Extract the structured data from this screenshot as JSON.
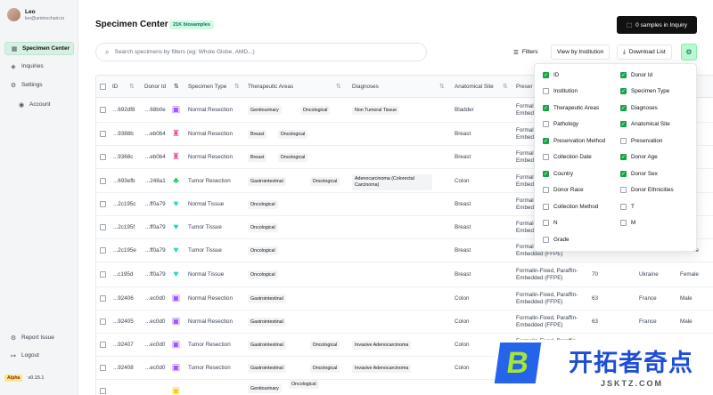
{
  "user": {
    "name": "Leo",
    "email": "leo@aminochain.io"
  },
  "nav": {
    "specimen_center": "Specimen Center",
    "inquiries": "Inquiries",
    "settings": "Settings",
    "account": "Account",
    "report_issue": "Report Issue",
    "logout": "Logout"
  },
  "version": {
    "badge": "Alpha",
    "number": "v0.15.1"
  },
  "header": {
    "title": "Specimen Center",
    "count_badge": "21K biosamples",
    "inquiry_button": "0 samples in Inquiry"
  },
  "search": {
    "placeholder": "Search specimens by filters (eg: Whole Globe, AMD...)"
  },
  "toolbar": {
    "filters": "Filters",
    "view_by_institution": "View by Institution",
    "download_list": "Download List"
  },
  "table": {
    "columns": [
      "ID",
      "Donor Id",
      "Specimen Type",
      "Therapeutic Areas",
      "Diagnoses",
      "Anatomical Site",
      "Preser"
    ],
    "rows": [
      {
        "id": "...692df8",
        "donor": "...68b0e",
        "icon": "ico-purple",
        "type": "Normal Resection",
        "areas": [
          "Genitourinary",
          "Oncological"
        ],
        "diagnosis": "Non Tumoral Tissue",
        "site": "Bladder",
        "pres": [
          "Formal",
          "Embedd"
        ],
        "age": "",
        "country": "",
        "sex": ""
      },
      {
        "id": "...9388b",
        "donor": "...eb0b4",
        "icon": "ico-pink",
        "type": "Normal Resection",
        "areas": [
          "Breast",
          "Oncological"
        ],
        "diagnosis": "",
        "site": "Breast",
        "pres": [
          "Formal",
          "Embedd"
        ],
        "age": "",
        "country": "",
        "sex": ""
      },
      {
        "id": "...9368c",
        "donor": "...eb0b4",
        "icon": "ico-pink",
        "type": "Normal Resection",
        "areas": [
          "Breast",
          "Oncological"
        ],
        "diagnosis": "",
        "site": "Breast",
        "pres": [
          "Formal",
          "Embedd"
        ],
        "age": "",
        "country": "",
        "sex": ""
      },
      {
        "id": "...693efb",
        "donor": "...248a1",
        "icon": "ico-green",
        "type": "Tumor Resection",
        "areas": [
          "Gastrointestinal",
          "Oncological"
        ],
        "diagnosis": "Adenocarcinoma (Colorectal Carcinoma)",
        "site": "Colon",
        "pres": [
          "Formal",
          "Embedd"
        ],
        "age": "",
        "country": "",
        "sex": ""
      },
      {
        "id": "...2c195c",
        "donor": "...ff0a79",
        "icon": "ico-teal",
        "type": "Normal Tissue",
        "areas": [
          "Oncological"
        ],
        "diagnosis": "",
        "site": "Breast",
        "pres": [
          "Formal",
          "Embedd"
        ],
        "age": "",
        "country": "",
        "sex": ""
      },
      {
        "id": "...2c195f",
        "donor": "...ff0a79",
        "icon": "ico-teal",
        "type": "Tumor Tissue",
        "areas": [
          "Oncological"
        ],
        "diagnosis": "",
        "site": "Breast",
        "pres": [
          "Formal",
          "Embedd"
        ],
        "age": "",
        "country": "",
        "sex": ""
      },
      {
        "id": "...2c195e",
        "donor": "...ff0a79",
        "icon": "ico-teal",
        "type": "Tumor Tissue",
        "areas": [
          "Oncological"
        ],
        "diagnosis": "",
        "site": "Breast",
        "pres": [
          "Formal",
          "Embedded (FFPE)"
        ],
        "age": "70",
        "country": "Ukraine",
        "sex": "Female"
      },
      {
        "id": "...c195d",
        "donor": "...ff0a79",
        "icon": "ico-teal",
        "type": "Normal Tissue",
        "areas": [
          "Oncological"
        ],
        "diagnosis": "",
        "site": "Breast",
        "pres": [
          "Formalin-Fixed, Paraffin-",
          "Embedded (FFPE)"
        ],
        "age": "70",
        "country": "Ukraine",
        "sex": "Female"
      },
      {
        "id": "...92406",
        "donor": "...ec0d0",
        "icon": "ico-purple",
        "type": "Normal Resection",
        "areas": [
          "Gastrointestinal"
        ],
        "diagnosis": "",
        "site": "Colon",
        "pres": [
          "Formalin-Fixed, Paraffin-",
          "Embedded (FFPE)"
        ],
        "age": "63",
        "country": "France",
        "sex": "Male"
      },
      {
        "id": "...92405",
        "donor": "...ec0d0",
        "icon": "ico-purple",
        "type": "Normal Resection",
        "areas": [
          "Gastrointestinal"
        ],
        "diagnosis": "",
        "site": "Colon",
        "pres": [
          "Formalin-Fixed, Paraffin-",
          "Embedded (FFPE)"
        ],
        "age": "63",
        "country": "France",
        "sex": "Male"
      },
      {
        "id": "...92407",
        "donor": "...ec0d0",
        "icon": "ico-purple",
        "type": "Tumor Resection",
        "areas": [
          "Gastrointestinal",
          "Oncological"
        ],
        "diagnosis": "Invasive Adenocarcinoma",
        "site": "Colon",
        "pres": [
          "Formalin-Fixed, Paraffin-",
          "Embedded (FFPE)"
        ],
        "age": "",
        "country": "",
        "sex": ""
      },
      {
        "id": "...92408",
        "donor": "...ec0d0",
        "icon": "ico-purple",
        "type": "Tumor Resection",
        "areas": [
          "Gastrointestinal",
          "Oncological"
        ],
        "diagnosis": "Invasive Adenocarcinoma",
        "site": "Colon",
        "pres": [
          "Formalin-Fixed, Paraffin-",
          "Embedded (FFPE)"
        ],
        "age": "",
        "country": "",
        "sex": ""
      },
      {
        "id": "",
        "donor": "",
        "icon": "ico-yellow",
        "type": "",
        "areas": [
          "Genitourinary",
          "Oncological"
        ],
        "diagnosis": "",
        "site": "",
        "pres": [
          "",
          ""
        ],
        "age": "",
        "country": "",
        "sex": ""
      }
    ]
  },
  "column_options": [
    {
      "label": "ID",
      "checked": true
    },
    {
      "label": "Donor Id",
      "checked": true
    },
    {
      "label": "Institution",
      "checked": false
    },
    {
      "label": "Specimen Type",
      "checked": true
    },
    {
      "label": "Therapeutic Areas",
      "checked": true
    },
    {
      "label": "Diagnoses",
      "checked": true
    },
    {
      "label": "Pathology",
      "checked": false
    },
    {
      "label": "Anatomical Site",
      "checked": true
    },
    {
      "label": "Preservation Method",
      "checked": true
    },
    {
      "label": "Preservation",
      "checked": false
    },
    {
      "label": "Collection Date",
      "checked": false
    },
    {
      "label": "Donor Age",
      "checked": true
    },
    {
      "label": "Country",
      "checked": true
    },
    {
      "label": "Donor Sex",
      "checked": true
    },
    {
      "label": "Donor Race",
      "checked": false
    },
    {
      "label": "Donor Ethnicities",
      "checked": false
    },
    {
      "label": "Collection Method",
      "checked": false
    },
    {
      "label": "T",
      "checked": false
    },
    {
      "label": "N",
      "checked": false
    },
    {
      "label": "M",
      "checked": false
    },
    {
      "label": "Grade",
      "checked": false
    }
  ],
  "watermark": {
    "logo_letter": "B",
    "text": "开拓者奇点",
    "url": "JSKTZ.COM"
  },
  "colors": {
    "accent": "#16a34a",
    "active_nav": "#d7f0e3",
    "primary_button": "#111111"
  }
}
